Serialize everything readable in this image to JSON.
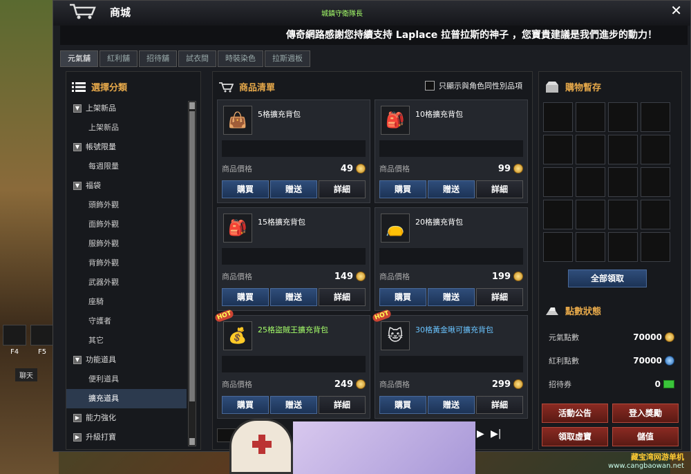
{
  "window": {
    "title": "商城",
    "guild_title": "城鎮守衛隊長",
    "banner": "傳奇網路感謝您持續支持 Laplace 拉普拉斯的神子 ，您寶貴建議是我們進步的動力！"
  },
  "tabs": [
    {
      "label": "元氣舖",
      "active": true
    },
    {
      "label": "紅利舖",
      "active": false
    },
    {
      "label": "招待舖",
      "active": false
    },
    {
      "label": "試衣間",
      "active": false
    },
    {
      "label": "時裝染色",
      "active": false
    },
    {
      "label": "拉斯週板",
      "active": false
    }
  ],
  "categories": {
    "header": "選擇分類",
    "items": [
      {
        "label": "上架新品",
        "type": "parent"
      },
      {
        "label": "上架新品",
        "type": "child"
      },
      {
        "label": "帳號限量",
        "type": "parent"
      },
      {
        "label": "每週限量",
        "type": "child"
      },
      {
        "label": "福袋",
        "type": "parent"
      },
      {
        "label": "頭飾外觀",
        "type": "child"
      },
      {
        "label": "面飾外觀",
        "type": "child"
      },
      {
        "label": "服飾外觀",
        "type": "child"
      },
      {
        "label": "背飾外觀",
        "type": "child"
      },
      {
        "label": "武器外觀",
        "type": "child"
      },
      {
        "label": "座騎",
        "type": "child"
      },
      {
        "label": "守護者",
        "type": "child"
      },
      {
        "label": "其它",
        "type": "child"
      },
      {
        "label": "功能道具",
        "type": "parent"
      },
      {
        "label": "便利道具",
        "type": "child"
      },
      {
        "label": "擴充道具",
        "type": "child",
        "selected": true
      },
      {
        "label": "能力強化",
        "type": "parent",
        "collapsed": true
      },
      {
        "label": "升級打寶",
        "type": "parent",
        "collapsed": true
      }
    ]
  },
  "products": {
    "header": "商品清單",
    "filter_label": "只顯示與角色同性別品項",
    "price_label": "商品價格",
    "buy_label": "購買",
    "gift_label": "贈送",
    "detail_label": "詳細",
    "items": [
      {
        "name": "5格擴充背包",
        "price": "49",
        "icon": "bag-icon",
        "hot": false,
        "color": "white"
      },
      {
        "name": "10格擴充背包",
        "price": "99",
        "icon": "bag-icon",
        "hot": false,
        "color": "white"
      },
      {
        "name": "15格擴充背包",
        "price": "149",
        "icon": "bag-icon",
        "hot": false,
        "color": "white"
      },
      {
        "name": "20格擴充背包",
        "price": "199",
        "icon": "bag-icon",
        "hot": false,
        "color": "white"
      },
      {
        "name": "25格盜賊王擴充背包",
        "price": "249",
        "icon": "thief-bag-icon",
        "hot": true,
        "color": "gold"
      },
      {
        "name": "30格黃金啾可擴充背包",
        "price": "299",
        "icon": "golden-pet-bag-icon",
        "hot": true,
        "color": "blue"
      }
    ],
    "hot_badge": "HOT"
  },
  "cart": {
    "header": "購物暫存",
    "claim_all": "全部領取",
    "slots": 20
  },
  "points": {
    "header": "點數狀態",
    "rows": [
      {
        "label": "元氣點數",
        "value": "70000",
        "icon": "gold-coin-icon"
      },
      {
        "label": "紅利點數",
        "value": "70000",
        "icon": "blue-coin-icon"
      },
      {
        "label": "招待券",
        "value": "0",
        "icon": "ticket-icon"
      }
    ]
  },
  "actions": [
    "活動公告",
    "登入獎勵",
    "領取虛寶",
    "儲值"
  ],
  "hotkeys": {
    "f4": "F4",
    "f5": "F5",
    "chat": "聊天"
  },
  "watermark": {
    "line1": "藏宝湾网游单机",
    "line2": "www.cangbaowan.net"
  },
  "colors": {
    "accent": "#e7a94a",
    "button_blue": "#2f4d7a",
    "button_red": "#8a2a22"
  }
}
